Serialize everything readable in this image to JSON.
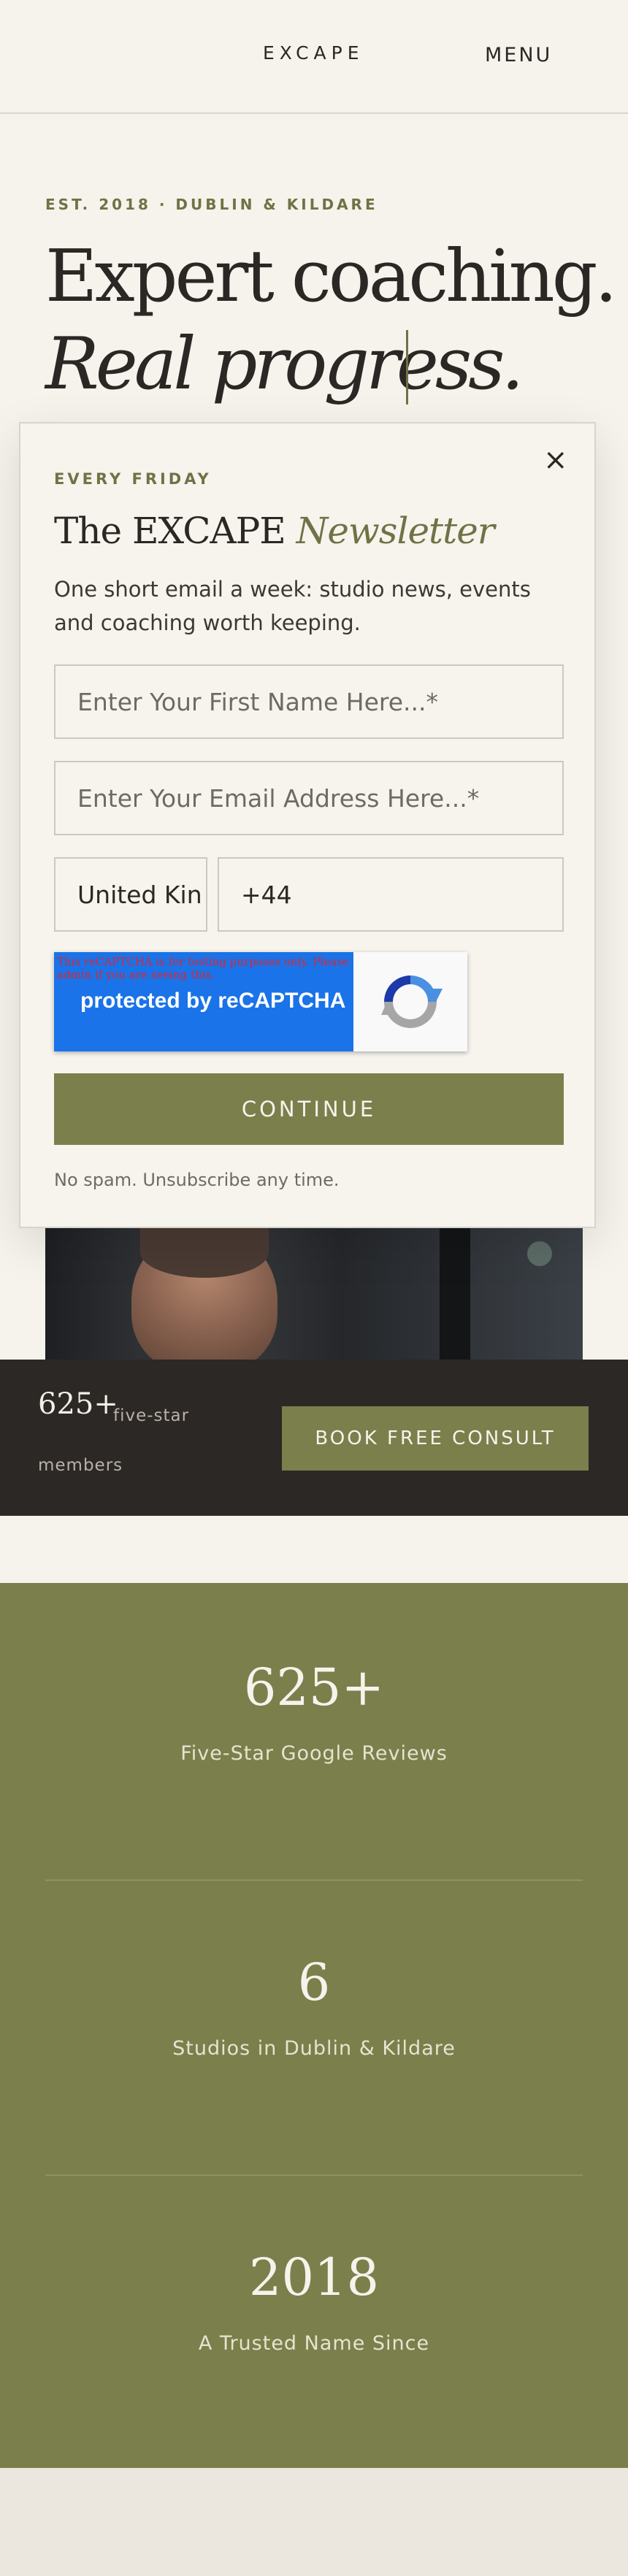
{
  "header": {
    "logo": "EXCAPE",
    "menu_label": "MENU"
  },
  "hero": {
    "eyebrow": "EST. 2018 · DUBLIN & KILDARE",
    "line1": "Expert coaching.",
    "line2": "Real progress."
  },
  "stats_bar": {
    "number": "625+",
    "label_part1": "five-star",
    "label_part2": "members",
    "button_label": "BOOK FREE CONSULT"
  },
  "stats": [
    {
      "value": "625+",
      "caption": "Five-Star Google Reviews"
    },
    {
      "value": "6",
      "caption": "Studios in Dublin & Kildare"
    },
    {
      "value": "2018",
      "caption": "A Trusted Name Since"
    }
  ],
  "modal": {
    "close_label": "×",
    "eyebrow": "EVERY FRIDAY",
    "title_plain": "The EXCAPE ",
    "title_italic": "Newsletter",
    "description": "One short email a week: studio news, events and coaching worth keeping.",
    "first_name_placeholder": "Enter Your First Name Here...*",
    "email_placeholder": "Enter Your Email Address Here...*",
    "country_value": "United Kin",
    "phone_value": "+44",
    "captcha_warning": "This reCAPTCHA is for testing purposes only. Please report to the site admin if you are seeing this.",
    "captcha_label": "protected by reCAPTCHA",
    "continue_label": "CONTINUE",
    "footnote": "No spam. Unsubscribe any time."
  },
  "colors": {
    "accent": "#7b7f4b",
    "background": "#f6f3ec",
    "dark": "#2c2826",
    "captcha_blue": "#1a73e8"
  }
}
